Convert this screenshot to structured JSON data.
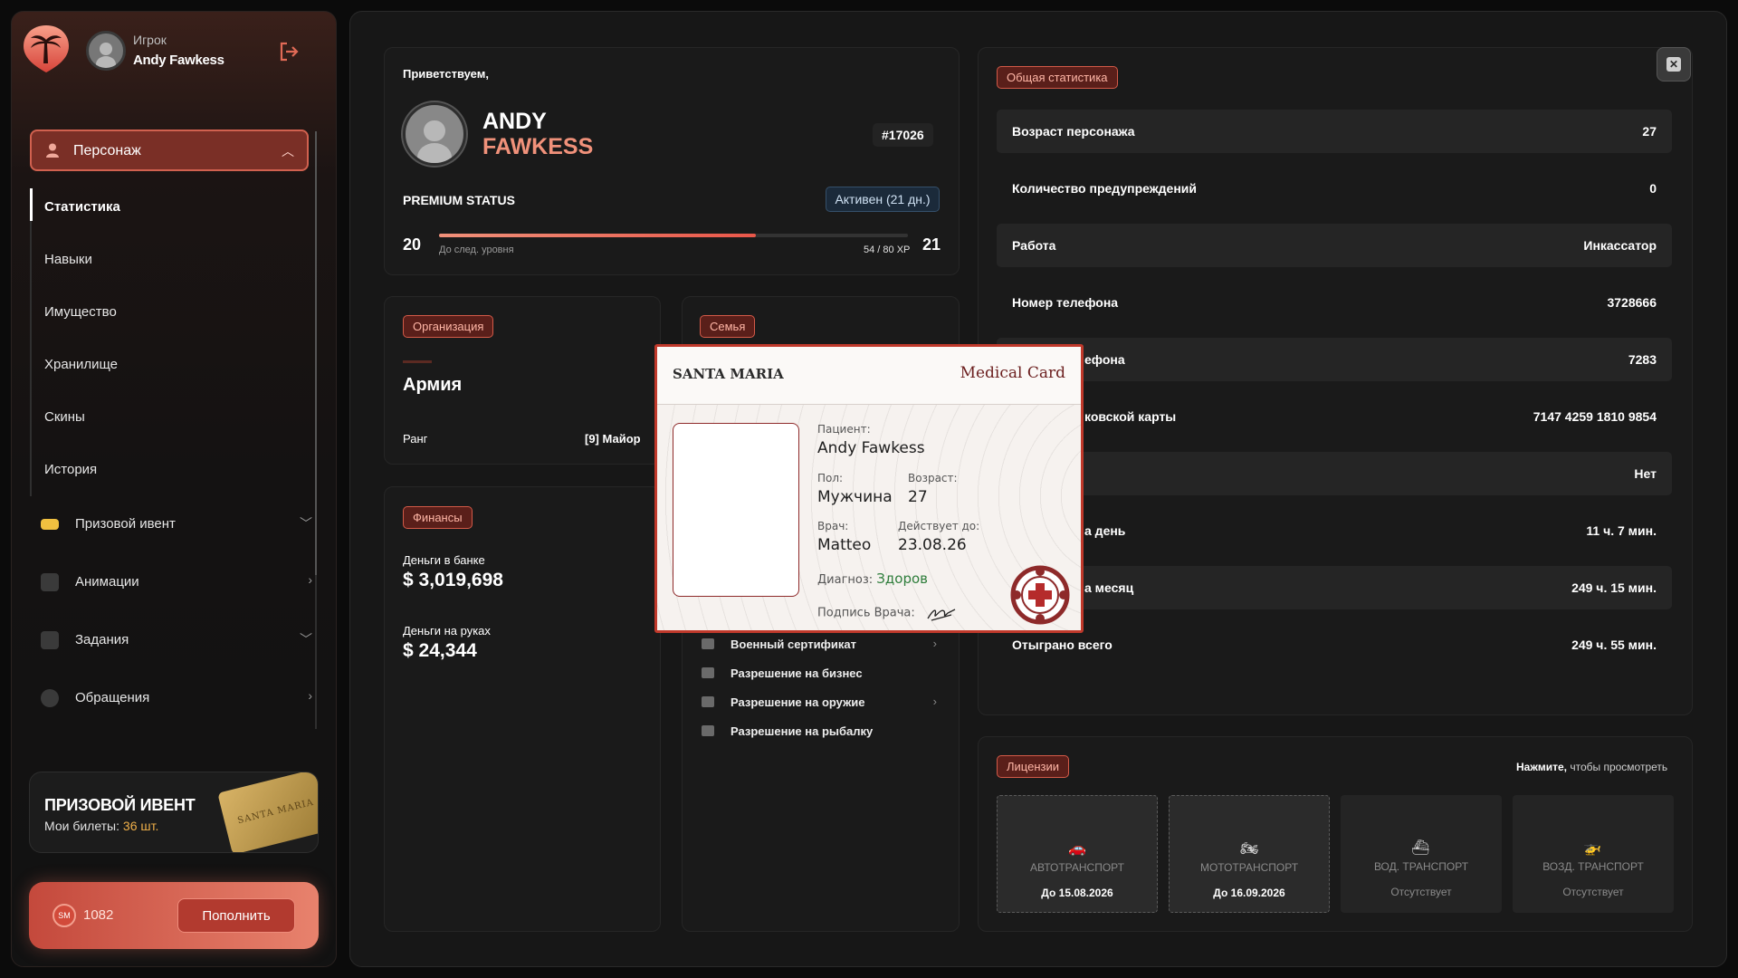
{
  "sidebar": {
    "user_role": "Игрок",
    "user_name": "Andy Fawkess",
    "main_menu": {
      "label": "Персонаж"
    },
    "sub_items": [
      "Статистика",
      "Навыки",
      "Имущество",
      "Хранилище",
      "Скины",
      "История"
    ],
    "menu_items": [
      "Призовой ивент",
      "Анимации",
      "Задания",
      "Обращения"
    ],
    "event": {
      "title": "ПРИЗОВОЙ ИВЕНТ",
      "tickets_label": "Мои билеты:",
      "tickets_value": "36 шт.",
      "ticket_text": "SANTA MARIA"
    },
    "balance": {
      "coin": "SM",
      "value": "1082",
      "topup_label": "Пополнить"
    }
  },
  "welcome": {
    "greeting": "Приветствуем,",
    "first_name": "ANDY",
    "last_name": "FAWKESS",
    "id": "#17026",
    "premium_label": "PREMIUM STATUS",
    "premium_status": "Активен (21 дн.)",
    "level_current": "20",
    "level_next": "21",
    "xp_note": "До след. уровня",
    "xp_value": "54 / 80 XP",
    "xp_progress": 0.675
  },
  "organization": {
    "tag": "Организация",
    "name": "Армия",
    "rank_label": "Ранг",
    "rank_value": "[9] Майор"
  },
  "finances": {
    "tag": "Финансы",
    "bank_label": "Деньги в банке",
    "bank_value": "$ 3,019,698",
    "cash_label": "Деньги на руках",
    "cash_value": "$ 24,344"
  },
  "family": {
    "tag": "Семья"
  },
  "documents": [
    {
      "label": "Военный сертификат",
      "chevron": "›"
    },
    {
      "label": "Разрешение на бизнес",
      "chevron": ""
    },
    {
      "label": "Разрешение на оружие",
      "chevron": "›"
    },
    {
      "label": "Разрешение на рыбалку",
      "chevron": ""
    }
  ],
  "stats": {
    "tag": "Общая статистика",
    "rows": [
      {
        "k": "Возраст персонажа",
        "v": "27"
      },
      {
        "k": "Количество предупреждений",
        "v": "0"
      },
      {
        "k": "Работа",
        "v": "Инкассатор"
      },
      {
        "k": "Номер телефона",
        "v": "3728666"
      },
      {
        "k": "ефона",
        "v": "7283"
      },
      {
        "k": "ковской карты",
        "v": "7147 4259 1810 9854"
      },
      {
        "k": "",
        "v": "Нет"
      },
      {
        "k": "а день",
        "v": "11 ч. 7 мин."
      },
      {
        "k": "а месяц",
        "v": "249 ч. 15 мин."
      },
      {
        "k": "Отыграно всего",
        "v": "249 ч. 55 мин."
      }
    ]
  },
  "licenses": {
    "tag": "Лицензии",
    "hint_bold": "Нажмите,",
    "hint_rest": " чтобы просмотреть",
    "cards": [
      {
        "icon": "car-icon",
        "glyph": "🚗",
        "title": "АВТОТРАНСПОРТ",
        "detail": "До 15.08.2026",
        "valid": true
      },
      {
        "icon": "motorcycle-icon",
        "glyph": "🏍",
        "title": "МОТОТРАНСПОРТ",
        "detail": "До 16.09.2026",
        "valid": true
      },
      {
        "icon": "boat-icon",
        "glyph": "⛴",
        "title": "ВОД. ТРАНСПОРТ",
        "detail": "Отсутствует",
        "valid": false
      },
      {
        "icon": "helicopter-icon",
        "glyph": "🚁",
        "title": "ВОЗД. ТРАНСПОРТ",
        "detail": "Отсутствует",
        "valid": false
      }
    ]
  },
  "medical_card": {
    "brand": "SANTA MARIA",
    "title": "Medical Card",
    "patient_label": "Пациент:",
    "patient_value": "Andy Fawkess",
    "sex_label": "Пол:",
    "sex_value": "Мужчина",
    "age_label": "Возраст:",
    "age_value": "27",
    "doctor_label": "Врач:",
    "doctor_value": "Matteo",
    "valid_label": "Действует до:",
    "valid_value": "23.08.26",
    "diagnosis_label": "Диагноз:",
    "diagnosis_value": "Здоров",
    "signature_label": "Подпись Врача:",
    "seal_text": "LOS SANTOS MEDICAL CENTER"
  },
  "colors": {
    "accent": "#e06a56",
    "tag_bg": "#5a1f1a",
    "active_badge": "#1b2a3a",
    "diagnosis": "#2e7d3b"
  }
}
